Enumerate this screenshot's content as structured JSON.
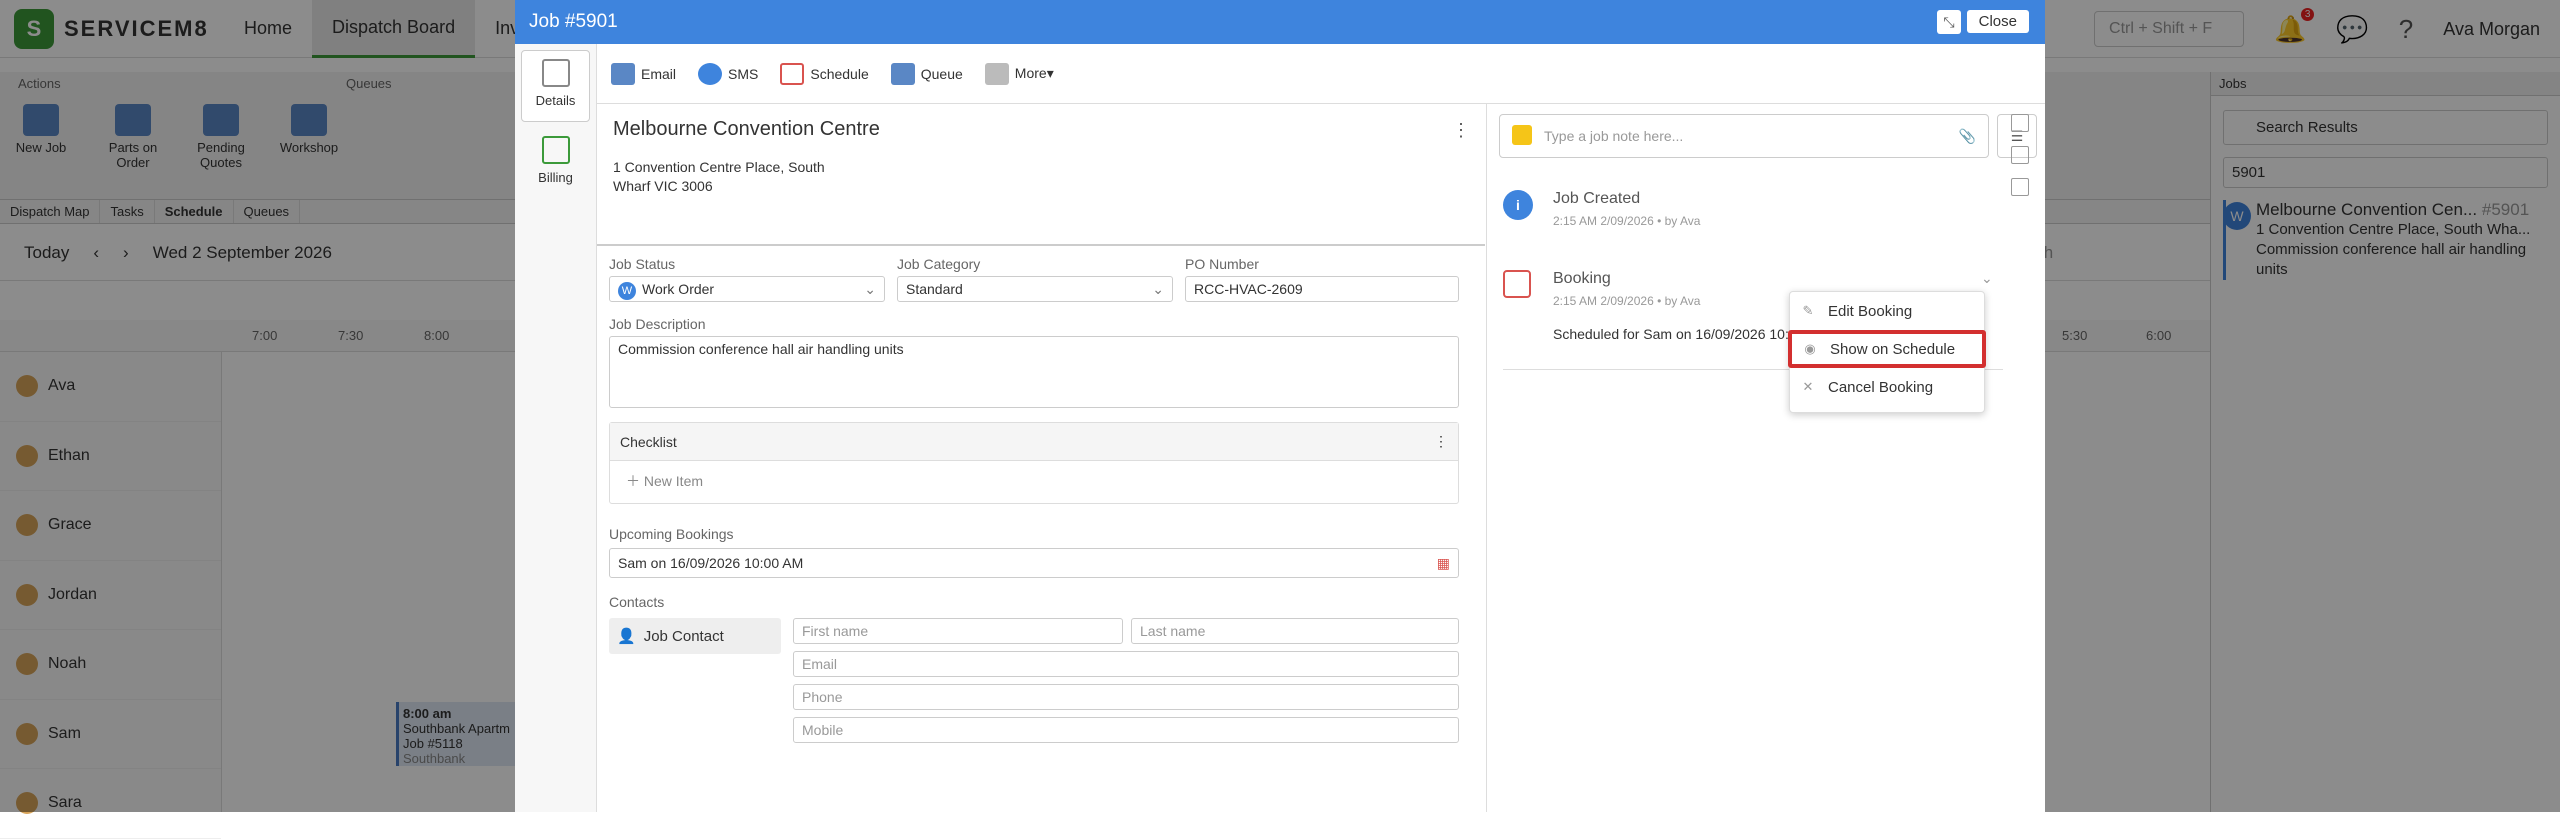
{
  "app": {
    "logo_mark": "S",
    "logo_text": "SERVICEM8"
  },
  "nav": [
    {
      "label": "Home"
    },
    {
      "label": "Dispatch Board"
    },
    {
      "label": "Inv"
    }
  ],
  "top_right": {
    "shortcut": "Ctrl + Shift + F",
    "notifications_count": "3",
    "user": "Ava Morgan"
  },
  "toolbar": {
    "actions_label": "Actions",
    "queues_label": "Queues",
    "new_job": "New Job",
    "parts_on_order": "Parts on Order",
    "pending_quotes": "Pending Quotes",
    "workshop": "Workshop"
  },
  "view_tabs": [
    "Dispatch Map",
    "Tasks",
    "Schedule",
    "Queues"
  ],
  "datebar": {
    "today": "Today",
    "date": "Wed 2 September 2026",
    "month": "Month"
  },
  "times": [
    "7:00",
    "7:30",
    "8:00",
    "5:30",
    "6:00"
  ],
  "staff": [
    "Ava",
    "Ethan",
    "Grace",
    "Jordan",
    "Noah",
    "Sam",
    "Sara"
  ],
  "booking_card": {
    "time": "8:00 am",
    "location": "Southbank Apartm",
    "job": "Job #5118",
    "sub": "Southbank"
  },
  "jobs_panel": {
    "title": "Jobs",
    "search_mode": "Search Results",
    "query": "5901",
    "result_badge": "W",
    "result_title": "Melbourne Convention Cen...",
    "result_number": "#5901",
    "result_address": "1 Convention Centre Place, South Wha...",
    "result_desc": "Commission conference hall air handling units"
  },
  "modal": {
    "title": "Job #5901",
    "close_label": "Close",
    "side_tabs": [
      "Details",
      "Billing"
    ],
    "tools": [
      "Email",
      "SMS",
      "Schedule",
      "Queue",
      "More▾"
    ],
    "site_title": "Melbourne Convention Centre",
    "site_address": "1 Convention Centre Place, South Wharf VIC 3006",
    "job_status_label": "Job Status",
    "job_status_value": "Work Order",
    "job_status_badge": "W",
    "job_category_label": "Job Category",
    "job_category_value": "Standard",
    "po_label": "PO Number",
    "po_value": "RCC-HVAC-2609",
    "description_label": "Job Description",
    "description_value": "Commission conference hall air handling units",
    "checklist_label": "Checklist",
    "new_item": "New Item",
    "upcoming_label": "Upcoming Bookings",
    "upcoming_value": "Sam on 16/09/2026 10:00 AM",
    "contacts_label": "Contacts",
    "job_contact": "Job Contact",
    "first_name_ph": "First name",
    "last_name_ph": "Last name",
    "email_ph": "Email",
    "phone_ph": "Phone",
    "mobile_ph": "Mobile",
    "note_placeholder": "Type a job note here...",
    "feed": [
      {
        "title": "Job Created",
        "meta": "2:15 AM 2/09/2026 •  by Ava",
        "detail": ""
      },
      {
        "title": "Booking",
        "meta": "2:15 AM 2/09/2026 •  by Ava",
        "detail": "Scheduled for Sam on 16/09/2026 10:0"
      }
    ],
    "context_menu": [
      "Edit Booking",
      "Show on Schedule",
      "Cancel Booking"
    ]
  }
}
